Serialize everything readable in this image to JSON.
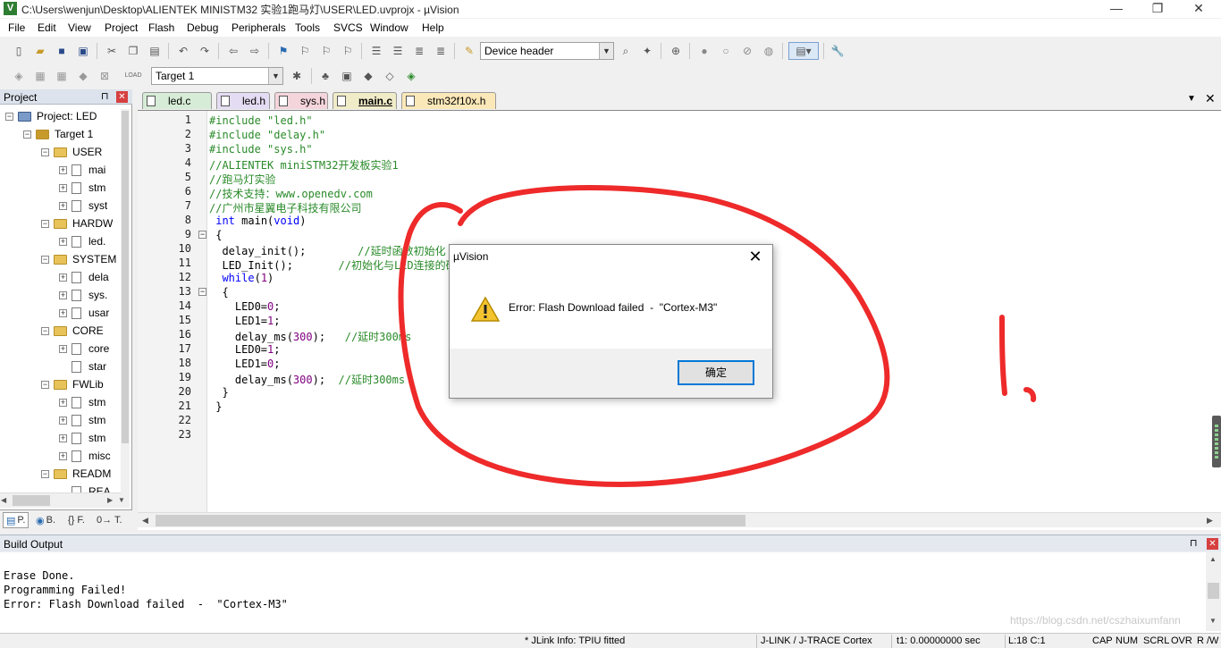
{
  "window": {
    "title": "C:\\Users\\wenjun\\Desktop\\ALIENTEK MINISTM32 实验1跑马灯\\USER\\LED.uvprojx - µVision",
    "icon_name": "uvision-app-icon",
    "minimize_glyph": "—",
    "restore_glyph": "❐",
    "close_glyph": "✕"
  },
  "menu": [
    "File",
    "Edit",
    "View",
    "Project",
    "Flash",
    "Debug",
    "Peripherals",
    "Tools",
    "SVCS",
    "Window",
    "Help"
  ],
  "toolbar": {
    "device_header_label": "Device header",
    "target_select": "Target 1"
  },
  "project": {
    "title": "Project",
    "pin_glyph": "⊓",
    "close_glyph": "✕",
    "tree": [
      {
        "label": "Project: LED",
        "level": 0,
        "kind": "project",
        "exp": "−"
      },
      {
        "label": "Target 1",
        "level": 1,
        "kind": "target",
        "exp": "−"
      },
      {
        "label": "USER",
        "level": 2,
        "kind": "folder",
        "exp": "−"
      },
      {
        "label": "mai",
        "level": 3,
        "kind": "file",
        "exp": "+"
      },
      {
        "label": "stm",
        "level": 3,
        "kind": "file",
        "exp": "+"
      },
      {
        "label": "syst",
        "level": 3,
        "kind": "file",
        "exp": "+"
      },
      {
        "label": "HARDW",
        "level": 2,
        "kind": "folder",
        "exp": "−"
      },
      {
        "label": "led.",
        "level": 3,
        "kind": "file",
        "exp": "+"
      },
      {
        "label": "SYSTEM",
        "level": 2,
        "kind": "folder",
        "exp": "−"
      },
      {
        "label": "dela",
        "level": 3,
        "kind": "file",
        "exp": "+"
      },
      {
        "label": "sys.",
        "level": 3,
        "kind": "file",
        "exp": "+"
      },
      {
        "label": "usar",
        "level": 3,
        "kind": "file",
        "exp": "+"
      },
      {
        "label": "CORE",
        "level": 2,
        "kind": "folder",
        "exp": "−"
      },
      {
        "label": "core",
        "level": 3,
        "kind": "file",
        "exp": "+"
      },
      {
        "label": "star",
        "level": 3,
        "kind": "file",
        "exp": ""
      },
      {
        "label": "FWLib",
        "level": 2,
        "kind": "folder",
        "exp": "−"
      },
      {
        "label": "stm",
        "level": 3,
        "kind": "file",
        "exp": "+"
      },
      {
        "label": "stm",
        "level": 3,
        "kind": "file",
        "exp": "+"
      },
      {
        "label": "stm",
        "level": 3,
        "kind": "file",
        "exp": "+"
      },
      {
        "label": "misc",
        "level": 3,
        "kind": "file",
        "exp": "+"
      },
      {
        "label": "READM",
        "level": 2,
        "kind": "folder",
        "exp": "−"
      },
      {
        "label": "REA",
        "level": 3,
        "kind": "file",
        "exp": ""
      }
    ],
    "bottom_tabs": [
      "P.",
      "B.",
      "{} F.",
      "0→ T."
    ]
  },
  "editor": {
    "tabs": [
      {
        "label": "led.c",
        "color": "#d6ecd6",
        "active": false
      },
      {
        "label": "led.h",
        "color": "#e4dcf2",
        "active": false
      },
      {
        "label": "sys.h",
        "color": "#f5d5dc",
        "active": false
      },
      {
        "label": "main.c",
        "color": "#f0ecc8",
        "active": true
      },
      {
        "label": "stm32f10x.h",
        "color": "#fbe8b8",
        "active": false
      }
    ],
    "menu_arrow": "▼",
    "close_glyph": "✕",
    "lines": [
      {
        "n": "1",
        "text": "#include \"led.h\"",
        "cls": "c-pp"
      },
      {
        "n": "2",
        "text": "#include \"delay.h\"",
        "cls": "c-pp"
      },
      {
        "n": "3",
        "text": "#include \"sys.h\"",
        "cls": "c-pp"
      },
      {
        "n": "4",
        "text": "//ALIENTEK miniSTM32开发板实验1",
        "cls": "c-cm"
      },
      {
        "n": "5",
        "text": "//跑马灯实验",
        "cls": "c-cm"
      },
      {
        "n": "6",
        "text": "//技术支持：www.openedv.com",
        "cls": "c-cm"
      },
      {
        "n": "7",
        "text": "//广州市星翼电子科技有限公司",
        "cls": "c-cm"
      },
      {
        "n": "8",
        "text": " int main(void)",
        "cls": ""
      },
      {
        "n": "9",
        "text": " {",
        "cls": ""
      },
      {
        "n": "10",
        "text": "  delay_init();        //延时函数初始化",
        "cls": ""
      },
      {
        "n": "11",
        "text": "  LED_Init();       //初始化与LED连接的硬件接口",
        "cls": ""
      },
      {
        "n": "12",
        "text": "  while(1)",
        "cls": ""
      },
      {
        "n": "13",
        "text": "  {",
        "cls": ""
      },
      {
        "n": "14",
        "text": "    LED0=0;",
        "cls": ""
      },
      {
        "n": "15",
        "text": "    LED1=1;",
        "cls": ""
      },
      {
        "n": "16",
        "text": "    delay_ms(300);   //延时300ms",
        "cls": ""
      },
      {
        "n": "17",
        "text": "    LED0=1;",
        "cls": ""
      },
      {
        "n": "18",
        "text": "    LED1=0;",
        "cls": ""
      },
      {
        "n": "19",
        "text": "    delay_ms(300);  //延时300ms",
        "cls": ""
      },
      {
        "n": "20",
        "text": "  }",
        "cls": ""
      },
      {
        "n": "21",
        "text": " }",
        "cls": ""
      },
      {
        "n": "22",
        "text": "",
        "cls": ""
      },
      {
        "n": "23",
        "text": "",
        "cls": ""
      }
    ]
  },
  "build_output": {
    "title": "Build Output",
    "lines": [
      "Erase Done.",
      "Programming Failed!",
      "Error: Flash Download failed  -  \"Cortex-M3\""
    ]
  },
  "status": {
    "jlink_info": "* JLink Info: TPIU fitted",
    "debugger": "J-LINK / J-TRACE Cortex",
    "time": "t1: 0.00000000 sec",
    "position": "L:18 C:1",
    "cap": "CAP",
    "num": "NUM",
    "scrl": "SCRL",
    "ovr": "OVR",
    "rw": "R /W"
  },
  "dialog": {
    "title": "µVision",
    "message": "Error: Flash Download failed  -  \"Cortex-M3\"",
    "ok_label": "确定",
    "close_glyph": "✕",
    "icon": "warning-icon"
  },
  "annotation": {
    "text": "1,",
    "color": "#ee2a2a"
  },
  "watermark": "https://blog.csdn.net/cszhaixumfann"
}
